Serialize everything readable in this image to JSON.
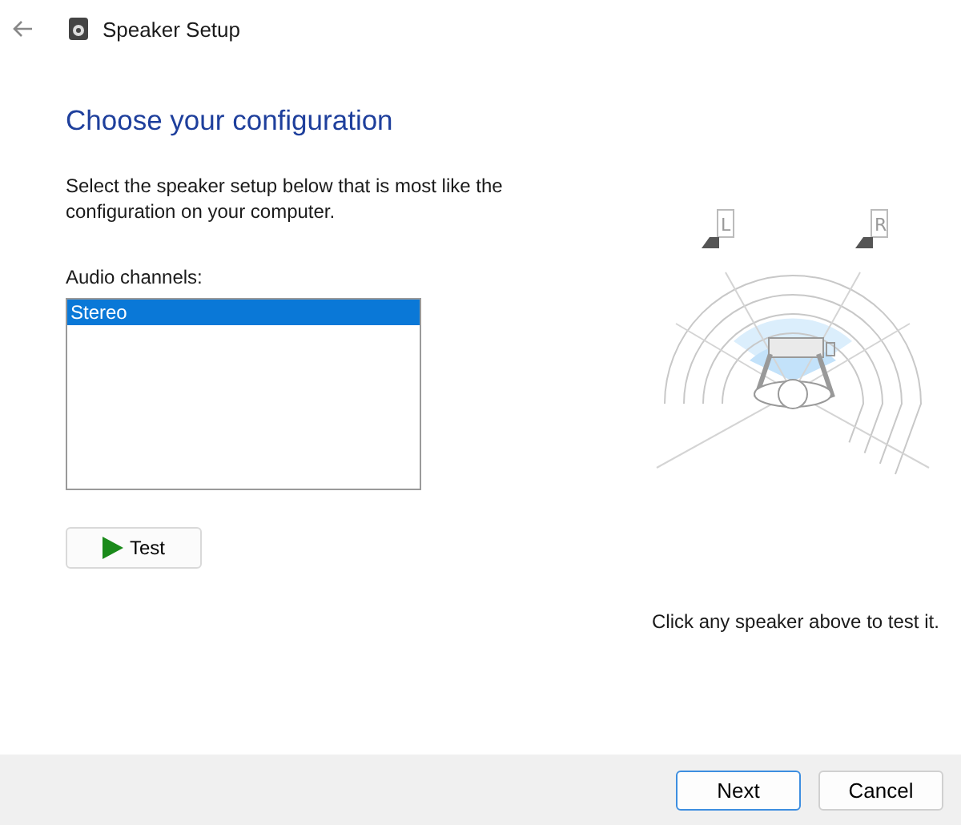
{
  "window": {
    "title": "Speaker Setup"
  },
  "heading": "Choose your configuration",
  "description": "Select the speaker setup below that is most like the configuration on your computer.",
  "channels": {
    "label": "Audio channels:",
    "options": [
      {
        "label": "Stereo",
        "selected": true
      }
    ]
  },
  "test_button": "Test",
  "speakers": [
    {
      "label": "L"
    },
    {
      "label": "R"
    }
  ],
  "hint": "Click any speaker above to test it.",
  "buttons": [
    {
      "label": "Next",
      "default": true
    },
    {
      "label": "Cancel",
      "default": false
    }
  ]
}
